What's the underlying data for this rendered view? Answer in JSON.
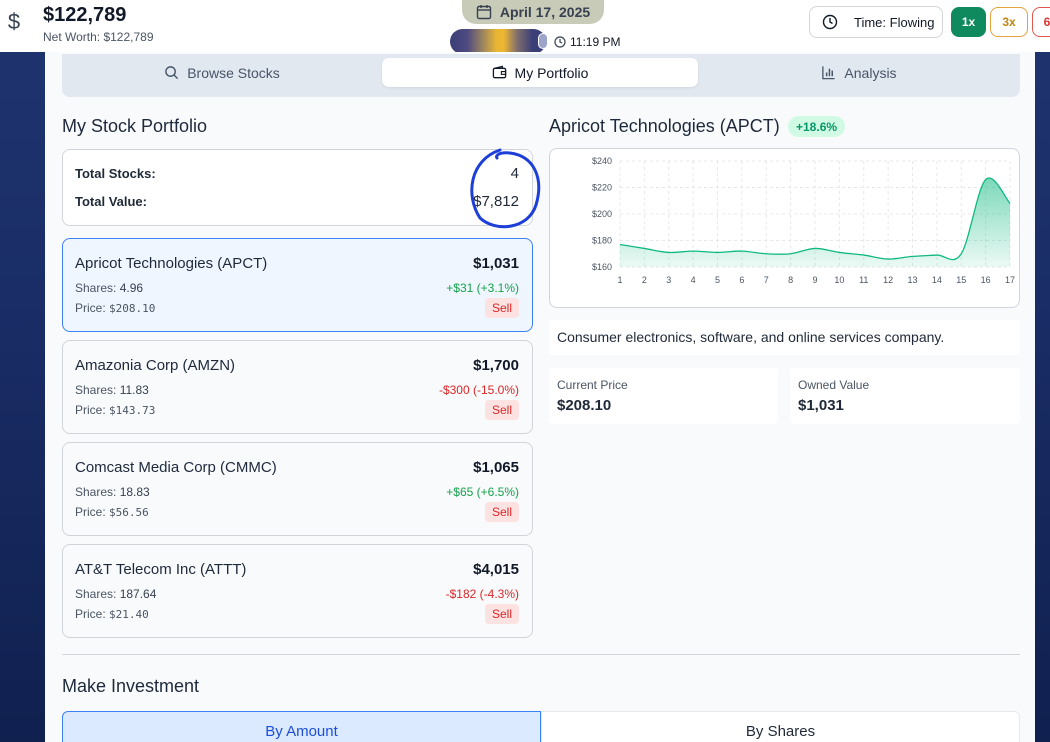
{
  "header": {
    "balance": "$122,789",
    "net_worth": "Net Worth: $122,789",
    "date": "April 17, 2025",
    "clock": "11:19 PM",
    "time_button": "Time: Flowing",
    "speeds": [
      "1x",
      "3x",
      "6"
    ]
  },
  "tabs": [
    {
      "label": "Browse Stocks",
      "icon": "search-icon"
    },
    {
      "label": "My Portfolio",
      "icon": "wallet-icon"
    },
    {
      "label": "Analysis",
      "icon": "bar-chart-icon"
    }
  ],
  "portfolio": {
    "title": "My Stock Portfolio",
    "total_stocks_label": "Total Stocks:",
    "total_stocks": "4",
    "total_value_label": "Total Value:",
    "total_value": "$7,812",
    "shares_label": "Shares:",
    "price_label": "Price:",
    "sell_label": "Sell",
    "holdings": [
      {
        "name": "Apricot Technologies (APCT)",
        "value": "$1,031",
        "shares": "4.96",
        "change": "+$31 (+3.1%)",
        "trend": "up",
        "price": "$208.10",
        "selected": true
      },
      {
        "name": "Amazonia Corp (AMZN)",
        "value": "$1,700",
        "shares": "11.83",
        "change": "-$300 (-15.0%)",
        "trend": "down",
        "price": "$143.73",
        "selected": false
      },
      {
        "name": "Comcast Media Corp (CMMC)",
        "value": "$1,065",
        "shares": "18.83",
        "change": "+$65 (+6.5%)",
        "trend": "up",
        "price": "$56.56",
        "selected": false
      },
      {
        "name": "AT&T Telecom Inc (ATTT)",
        "value": "$4,015",
        "shares": "187.64",
        "change": "-$182 (-4.3%)",
        "trend": "down",
        "price": "$21.40",
        "selected": false
      }
    ]
  },
  "detail": {
    "title": "Apricot Technologies (APCT)",
    "badge": "+18.6%",
    "description": "Consumer electronics, software, and online services company.",
    "current_price_label": "Current Price",
    "current_price": "$208.10",
    "owned_value_label": "Owned Value",
    "owned_value": "$1,031"
  },
  "chart_data": {
    "type": "area",
    "x": [
      1,
      2,
      3,
      4,
      5,
      6,
      7,
      8,
      9,
      10,
      11,
      12,
      13,
      14,
      15,
      16,
      17
    ],
    "x_tick_labels": [
      "1",
      "2",
      "3",
      "4",
      "5",
      "6",
      "7",
      "8",
      "9",
      "10",
      "11",
      "12",
      "13",
      "14",
      "15",
      "16",
      "17"
    ],
    "y": [
      177,
      174,
      171,
      172,
      171,
      172,
      170,
      170,
      174,
      171,
      169,
      166,
      168,
      169,
      170,
      226,
      208
    ],
    "y_tick_labels": [
      "$160",
      "$180",
      "$200",
      "$220",
      "$240"
    ],
    "y_ticks": [
      160,
      180,
      200,
      220,
      240
    ],
    "ylim": [
      160,
      240
    ],
    "xlim": [
      1,
      17
    ],
    "grid": true,
    "color": "#10b981"
  },
  "invest": {
    "title": "Make Investment",
    "by_amount": "By Amount",
    "by_shares": "By Shares"
  },
  "colors": {
    "accent_green": "#0f8a5f",
    "gain": "#16a34a",
    "loss": "#dc2626",
    "selected_border": "#3b82f6",
    "annotation": "#1d3fd8"
  }
}
